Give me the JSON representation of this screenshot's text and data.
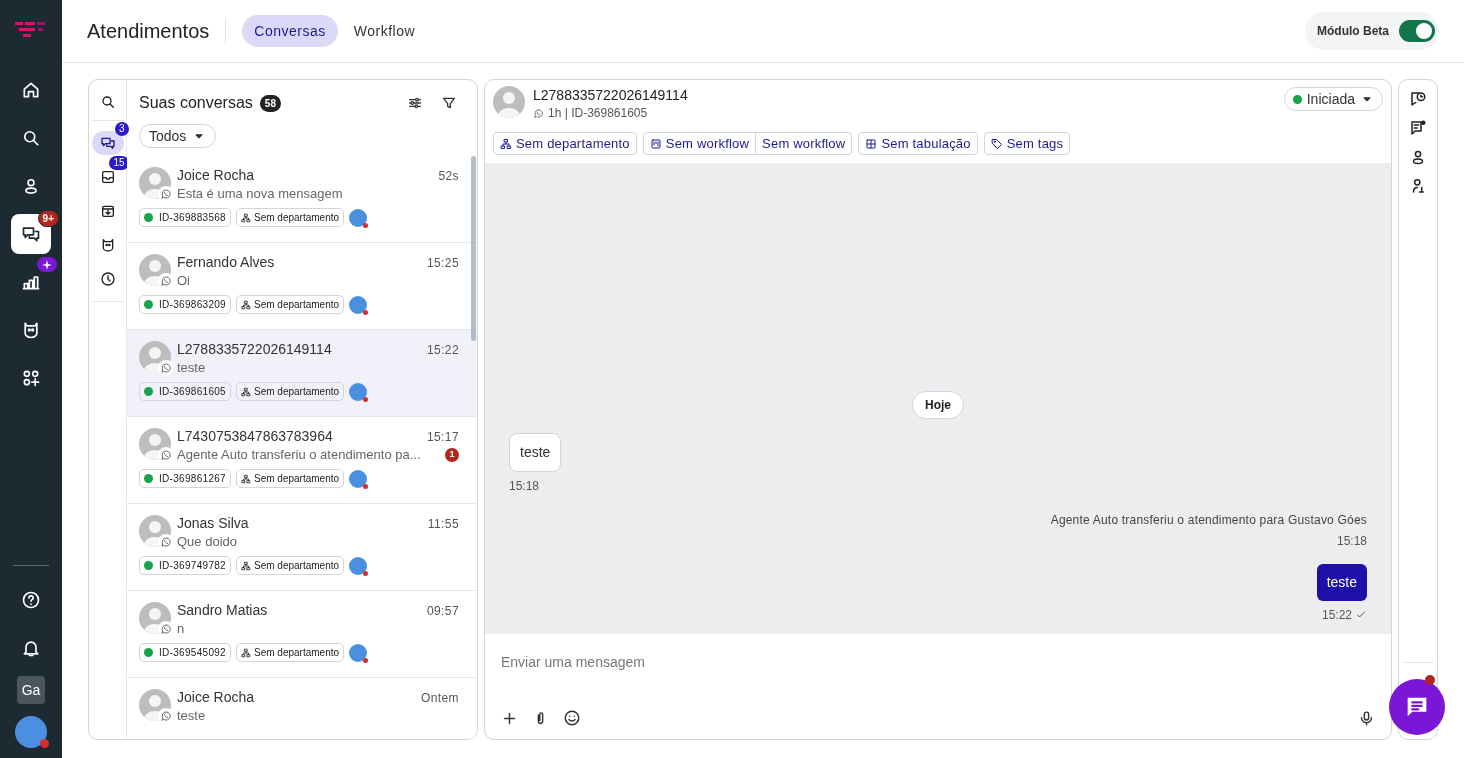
{
  "nav": {
    "items": [
      {
        "selected": false
      },
      {
        "selected": false
      },
      {
        "selected": false
      },
      {
        "selected": true,
        "badge": "9+"
      },
      {
        "selected": false,
        "new": true
      },
      {
        "selected": false
      },
      {
        "selected": false
      }
    ],
    "bottom": [
      {
        "kind": "help"
      },
      {
        "kind": "bell"
      },
      {
        "kind": "initials",
        "text": "Ga"
      },
      {
        "kind": "avatar",
        "alert": true
      }
    ]
  },
  "header": {
    "title": "Atendimentos",
    "tabs": [
      {
        "label": "Conversas",
        "selected": true
      },
      {
        "label": "Workflow",
        "selected": false
      }
    ],
    "beta": {
      "label": "Módulo Beta",
      "on": true
    }
  },
  "list": {
    "title": "Suas conversas",
    "count": "58",
    "filter": "Todos",
    "side_filters": [
      {
        "kind": "search",
        "selected": false
      },
      {
        "kind": "chats",
        "selected": true,
        "badge": "3"
      },
      {
        "kind": "inbox",
        "selected": false,
        "badge": "15"
      },
      {
        "kind": "archive",
        "selected": false
      },
      {
        "kind": "bot",
        "selected": false
      },
      {
        "kind": "history",
        "selected": false
      }
    ],
    "conversations": [
      {
        "name": "Joice Rocha",
        "preview": "Esta é uma nova mensagem",
        "time": "52s",
        "id": "ID-369883568",
        "department": "Sem departamento",
        "selected": false
      },
      {
        "name": "Fernando Alves",
        "preview": "Oi",
        "time": "15:25",
        "id": "ID-369863209",
        "department": "Sem departamento",
        "selected": false
      },
      {
        "name": "L2788335722026149114",
        "preview": "teste",
        "time": "15:22",
        "id": "ID-369861605",
        "department": "Sem departamento",
        "selected": true
      },
      {
        "name": "L7430753847863783964",
        "preview": "Agente Auto transferiu o atendimento pa...",
        "time": "15:17",
        "unread": "1",
        "id": "ID-369861267",
        "department": "Sem departamento",
        "selected": false
      },
      {
        "name": "Jonas Silva",
        "preview": "Que doido",
        "time": "11:55",
        "id": "ID-369749782",
        "department": "Sem departamento",
        "selected": false
      },
      {
        "name": "Sandro Matias",
        "preview": "n",
        "time": "09:57",
        "id": "ID-369545092",
        "department": "Sem departamento",
        "selected": false
      },
      {
        "name": "Joice Rocha",
        "preview": "teste",
        "time": "Ontem",
        "selected": false
      }
    ]
  },
  "chat": {
    "name": "L2788335722026149114",
    "meta": "1h | ID-369861605",
    "status": {
      "label": "Iniciada",
      "color": "#16a34a"
    },
    "tags": [
      {
        "kind": "department",
        "label": "Sem departamento"
      },
      {
        "kind": "workflow",
        "label": "Sem workflow",
        "extra": "Sem workflow"
      },
      {
        "kind": "tabulation",
        "label": "Sem tabulação"
      },
      {
        "kind": "tags",
        "label": "Sem tags"
      }
    ],
    "messages": [
      {
        "kind": "date",
        "text": "Hoje"
      },
      {
        "kind": "incoming",
        "text": "teste",
        "time": "15:18"
      },
      {
        "kind": "system",
        "text": "Agente Auto transferiu o atendimento para Gustavo Góes",
        "time": "15:18"
      },
      {
        "kind": "outgoing",
        "text": "teste",
        "time": "15:22",
        "delivered": true
      }
    ],
    "composer": {
      "placeholder": "Enviar uma mensagem"
    }
  },
  "fab": {
    "alert": true
  }
}
